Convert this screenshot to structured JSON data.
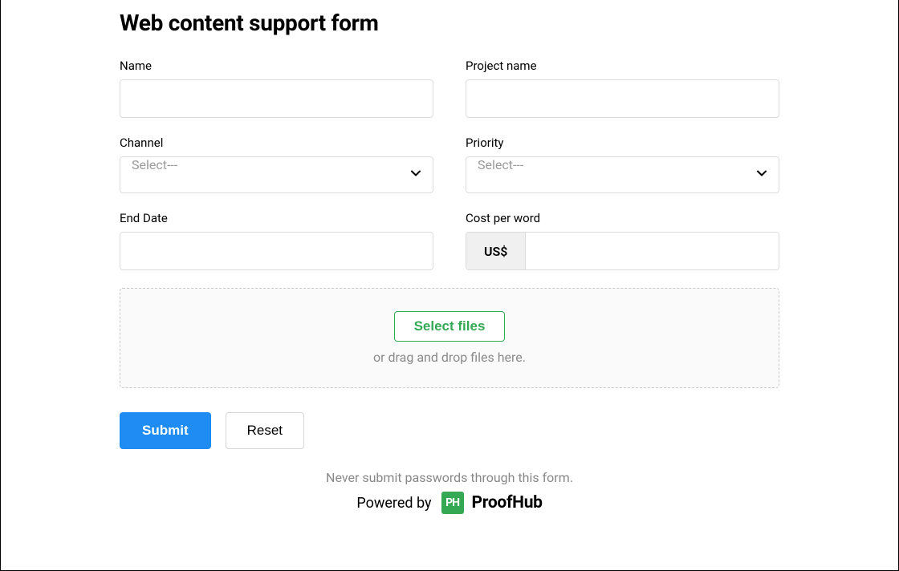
{
  "title": "Web content support form",
  "fields": {
    "name": {
      "label": "Name",
      "value": ""
    },
    "project_name": {
      "label": "Project name",
      "value": ""
    },
    "channel": {
      "label": "Channel",
      "placeholder": "Select---"
    },
    "priority": {
      "label": "Priority",
      "placeholder": "Select---"
    },
    "end_date": {
      "label": "End Date",
      "value": ""
    },
    "cost_per_word": {
      "label": "Cost per word",
      "currency_prefix": "US$",
      "value": ""
    }
  },
  "dropzone": {
    "button_label": "Select files",
    "hint": "or drag and drop files here."
  },
  "actions": {
    "submit": "Submit",
    "reset": "Reset"
  },
  "footer": {
    "disclaimer": "Never submit passwords through this form.",
    "powered_by": "Powered by",
    "brand_short": "PH",
    "brand_name": "ProofHub"
  }
}
